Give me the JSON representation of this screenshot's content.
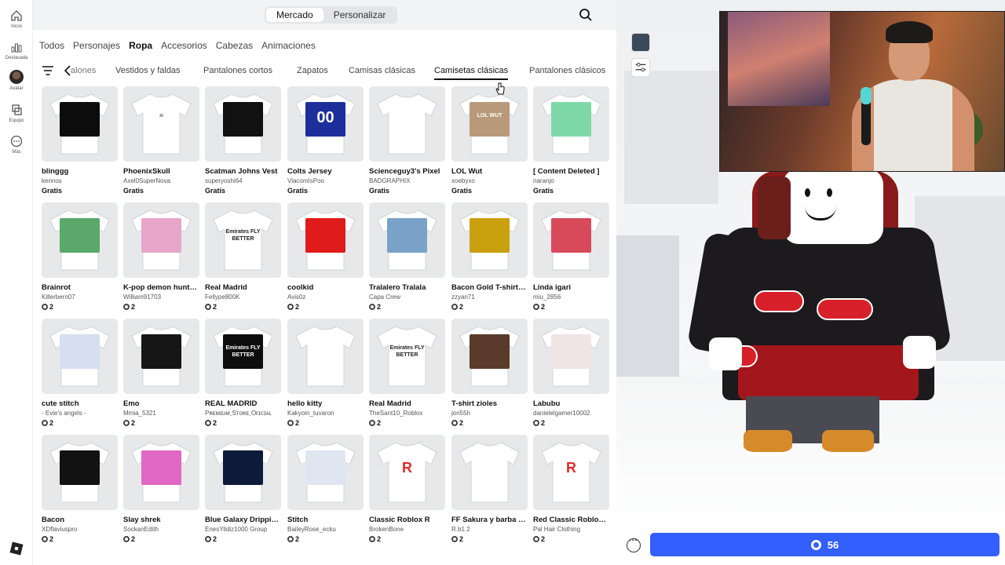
{
  "rail": {
    "items": [
      {
        "label": "Inicio",
        "icon": "home-icon"
      },
      {
        "label": "Destacada",
        "icon": "chart-icon"
      },
      {
        "label": "Avatar",
        "icon": "avatar-icon"
      },
      {
        "label": "Equipo",
        "icon": "team-icon"
      },
      {
        "label": "Más",
        "icon": "more-icon"
      }
    ],
    "logo": "roblox-logo"
  },
  "topbar": {
    "tabs": [
      {
        "label": "Mercado",
        "active": true
      },
      {
        "label": "Personalizar",
        "active": false
      }
    ],
    "search_icon": "search-icon"
  },
  "categories": [
    {
      "label": "Todos",
      "active": false
    },
    {
      "label": "Personajes",
      "active": false
    },
    {
      "label": "Ropa",
      "active": true
    },
    {
      "label": "Accesorios",
      "active": false
    },
    {
      "label": "Cabezas",
      "active": false
    },
    {
      "label": "Animaciones",
      "active": false
    }
  ],
  "subtabs": [
    {
      "label": "alones",
      "active": false
    },
    {
      "label": "Vestidos y faldas",
      "active": false
    },
    {
      "label": "Pantalones cortos",
      "active": false
    },
    {
      "label": "Zapatos",
      "active": false
    },
    {
      "label": "Camisas clásicas",
      "active": false
    },
    {
      "label": "Camisetas clásicas",
      "active": true
    },
    {
      "label": "Pantalones clásicos",
      "active": false
    }
  ],
  "items": [
    {
      "title": "blinggg",
      "creator": "kennos",
      "price": "Gratis",
      "robux": false,
      "art": "#0c0c0c",
      "art_text": "",
      "art_text_light": true
    },
    {
      "title": "PhoenixSkull",
      "creator": "Axel0SuperNova",
      "price": "Gratis",
      "robux": false,
      "art": "#ffffff",
      "art_text": "☠",
      "art_text_light": false
    },
    {
      "title": "Scatman Johns Vest",
      "creator": "superyoshi64",
      "price": "Gratis",
      "robux": false,
      "art": "#111111",
      "art_text": "",
      "art_text_light": true
    },
    {
      "title": "Colts Jersey",
      "creator": "ViacomIsPoo",
      "price": "Gratis",
      "robux": false,
      "art": "#1d2f9a",
      "art_text": "00",
      "art_text_light": true
    },
    {
      "title": "Scienceguy3's Pixel",
      "creator": "BADGRAPHIX",
      "price": "Gratis",
      "robux": false,
      "art": "#ffffff",
      "art_text": "",
      "art_text_light": false
    },
    {
      "title": "LOL Wut",
      "creator": "xoebyxo",
      "price": "Gratis",
      "robux": false,
      "art": "#b89a7a",
      "art_text": "LOL WUT",
      "art_text_light": true
    },
    {
      "title": "[ Content Deleted ]",
      "creator": "naranjo",
      "price": "Gratis",
      "robux": false,
      "art": "#7fd8a8",
      "art_text": "",
      "art_text_light": false
    },
    {
      "title": "Brainrot",
      "creator": "Killerbern07",
      "price": "2",
      "robux": true,
      "art": "#5aa86a",
      "art_text": "",
      "art_text_light": false
    },
    {
      "title": "K-pop demon hunte…",
      "creator": "William91703",
      "price": "2",
      "robux": true,
      "art": "#e7a6c9",
      "art_text": "",
      "art_text_light": false
    },
    {
      "title": "Real Madrid",
      "creator": "Fellype800K",
      "price": "2",
      "robux": true,
      "art": "#ffffff",
      "art_text": "Emirates FLY BETTER",
      "art_text_light": false
    },
    {
      "title": "coolkid",
      "creator": "Avis0z",
      "price": "2",
      "robux": true,
      "art": "#e01b1b",
      "art_text": "",
      "art_text_light": false
    },
    {
      "title": "Tralalero Tralala",
      "creator": "Capa Crew",
      "price": "2",
      "robux": true,
      "art": "#7aa2c8",
      "art_text": "",
      "art_text_light": false
    },
    {
      "title": "Bacon Gold T-shirt (…",
      "creator": "zzyan71",
      "price": "2",
      "robux": true,
      "art": "#c9a10e",
      "art_text": "",
      "art_text_light": false
    },
    {
      "title": "Linda igari",
      "creator": "miu_2856",
      "price": "2",
      "robux": true,
      "art": "#d84a5a",
      "art_text": "",
      "art_text_light": false
    },
    {
      "title": "cute stitch",
      "creator": "- Evie's angels -",
      "price": "2",
      "robux": true,
      "art": "#d6dff0",
      "art_text": "",
      "art_text_light": false
    },
    {
      "title": "Emo",
      "creator": "Mmia_5321",
      "price": "2",
      "robux": true,
      "art": "#161616",
      "art_text": "",
      "art_text_light": false
    },
    {
      "title": "REAL MADRID",
      "creator": "PʀᴇᴍɪᴜᴍˍSᴛᴏʀᴇˍOғɪᴄɪᴀʟ",
      "price": "2",
      "robux": true,
      "art": "#0d0d0d",
      "art_text": "Emirates FLY BETTER",
      "art_text_light": true
    },
    {
      "title": "hello kitty",
      "creator": "Kakyoin_tuvaron",
      "price": "2",
      "robux": true,
      "art": "#ffffff",
      "art_text": "",
      "art_text_light": false
    },
    {
      "title": "Real Madrid",
      "creator": "TheSant10_Roblox",
      "price": "2",
      "robux": true,
      "art": "#ffffff",
      "art_text": "Emirates FLY BETTER",
      "art_text_light": false
    },
    {
      "title": "T-shirt zioles",
      "creator": "jon55h",
      "price": "2",
      "robux": true,
      "art": "#5a3a2a",
      "art_text": "",
      "art_text_light": false
    },
    {
      "title": "Labubu",
      "creator": "danielelgamer10002",
      "price": "2",
      "robux": true,
      "art": "#f1e4e4",
      "art_text": "",
      "art_text_light": false
    },
    {
      "title": "Bacon",
      "creator": "XDflaviuspro",
      "price": "2",
      "robux": true,
      "art": "#121212",
      "art_text": "",
      "art_text_light": false
    },
    {
      "title": "Slay shrek",
      "creator": "SockanEdith",
      "price": "2",
      "robux": true,
      "art": "#e067c4",
      "art_text": "",
      "art_text_light": false
    },
    {
      "title": "Blue Galaxy Drippin…",
      "creator": "EnesYildiz1000 Group",
      "price": "2",
      "robux": true,
      "art": "#0d1a3a",
      "art_text": "",
      "art_text_light": false
    },
    {
      "title": "Stitch",
      "creator": "BaileyRose_ecku",
      "price": "2",
      "robux": true,
      "art": "#dfe6f2",
      "art_text": "",
      "art_text_light": false
    },
    {
      "title": "Classic Roblox R",
      "creator": "BrokenBone",
      "price": "2",
      "robux": true,
      "art": "#ffffff",
      "art_text": "R",
      "art_text_light": false
    },
    {
      "title": "FF Sakura y barba o…",
      "creator": "R.b1 2",
      "price": "2",
      "robux": true,
      "art": "#ffffff",
      "art_text": "",
      "art_text_light": false
    },
    {
      "title": "Red Classic Roblox …",
      "creator": "Pal Hair Clothing",
      "price": "2",
      "robux": true,
      "art": "#ffffff",
      "art_text": "R",
      "art_text_light": false
    }
  ],
  "preview": {
    "toolbar": [
      {
        "icon": "avatar-thumb-icon"
      },
      {
        "icon": "sliders-icon"
      }
    ],
    "buy_button": "56",
    "more_icon": "more-icon"
  },
  "colors": {
    "accent": "#335fff",
    "card_bg": "#e7e8ea"
  }
}
